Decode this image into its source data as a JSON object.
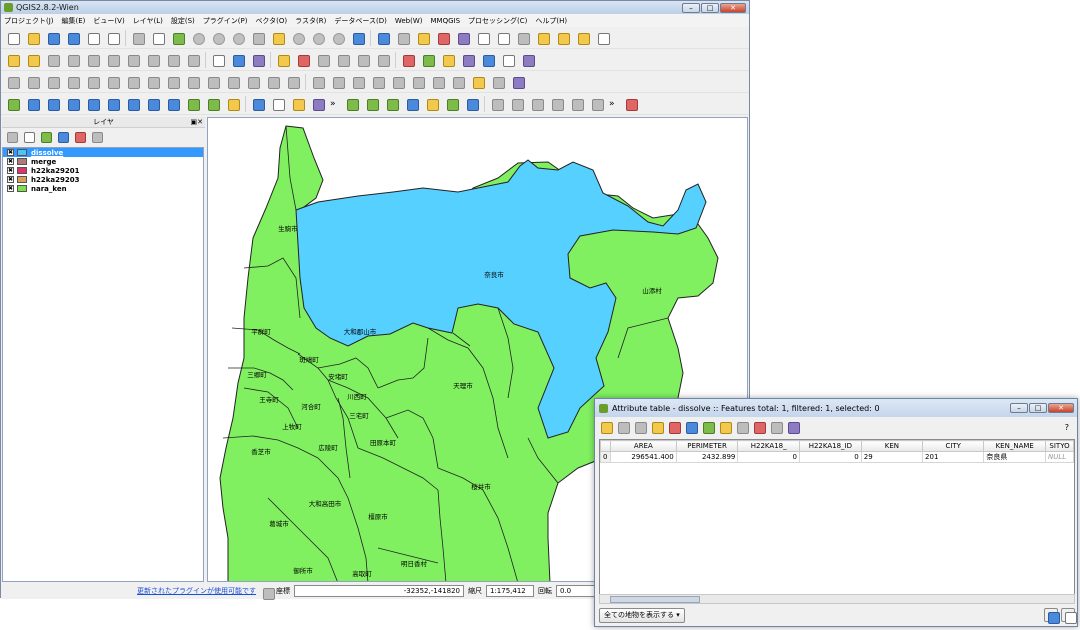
{
  "window": {
    "title": "QGIS2.8.2-Wien",
    "min": "–",
    "max": "□",
    "close": "✕"
  },
  "menu": [
    "プロジェクト(J)",
    "編集(E)",
    "ビュー(V)",
    "レイヤ(L)",
    "設定(S)",
    "プラグイン(P)",
    "ベクタ(O)",
    "ラスタ(R)",
    "データベース(D)",
    "Web(W)",
    "MMQGIS",
    "プロセッシング(C)",
    "ヘルプ(H)"
  ],
  "layers_panel": {
    "title": "レイヤ",
    "panel_buttons": "▣✕",
    "layers": [
      {
        "name": "dissolve",
        "color": "#4fc3f7",
        "checked": "✖"
      },
      {
        "name": "merge",
        "color": "#b07a7a",
        "checked": "✖"
      },
      {
        "name": "h22ka29201",
        "color": "#e0336a",
        "checked": "✖"
      },
      {
        "name": "h22ka29203",
        "color": "#d8a15a",
        "checked": "✖"
      },
      {
        "name": "nara_ken",
        "color": "#7de04a",
        "checked": "✖"
      }
    ]
  },
  "map": {
    "green": "#80f060",
    "blue": "#55d0ff",
    "labels": [
      "生駒市",
      "奈良市",
      "山添村",
      "大和郡山市",
      "平群町",
      "斑鳩町",
      "三郷町",
      "安堵町",
      "王寺町",
      "川西町",
      "河合町",
      "天理市",
      "三宅町",
      "上牧町",
      "広陵町",
      "田原本町",
      "香芝市",
      "桜井市",
      "大和高田市",
      "橿原市",
      "葛城市",
      "御所市",
      "高取町",
      "明日香村"
    ]
  },
  "status": {
    "plugin_link": "更新されたプラグインが使用可能です",
    "coord_label": "座標",
    "coord_value": "-32352,-141820",
    "scale_label": "縮尺",
    "scale_value": "1:175,412",
    "rotation_label": "回転",
    "rotation_value": "0.0"
  },
  "attribute_table": {
    "title": "Attribute table - dissolve :: Features total: 1, filtered: 1, selected: 0",
    "help": "?",
    "columns": [
      "AREA",
      "PERIMETER",
      "H22KA18_",
      "H22KA18_ID",
      "KEN",
      "CITY",
      "KEN_NAME",
      "SITYO"
    ],
    "rows": [
      {
        "index": "0",
        "cells": [
          "296541.400",
          "2432.899",
          "0",
          "0",
          "29",
          "201",
          "奈良県",
          "NULL"
        ]
      }
    ],
    "show_all": "全ての地物を表示する"
  }
}
